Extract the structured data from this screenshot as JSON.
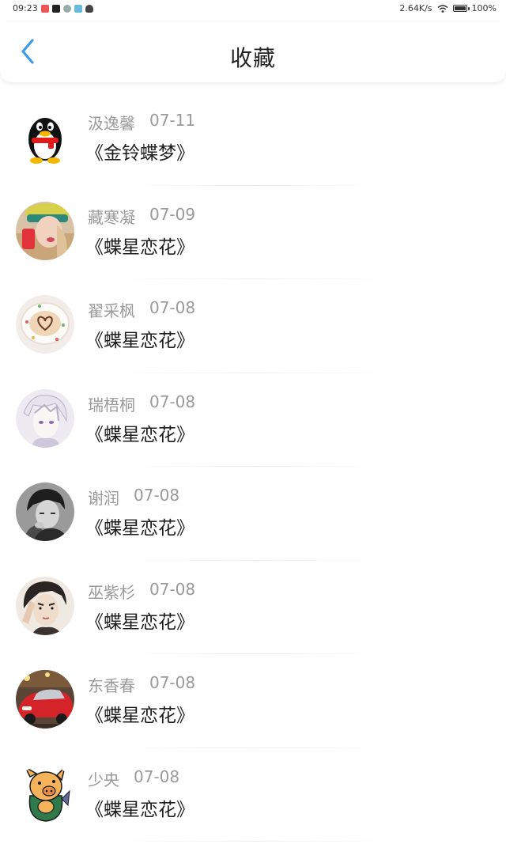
{
  "status_bar": {
    "time": "09:23",
    "net_speed": "2.64K/s",
    "battery": "100%"
  },
  "header": {
    "title": "收藏",
    "back_icon": "chevron-left-icon"
  },
  "colors": {
    "accent": "#3a9bea",
    "meta_text": "#9a9a9a",
    "title_text": "#1e1e1e"
  },
  "favorites": [
    {
      "user": "汲逸馨",
      "date": "07-11",
      "title": "《金铃蝶梦》",
      "avatar": "qq-penguin"
    },
    {
      "user": "藏寒凝",
      "date": "07-09",
      "title": "《蝶星恋花》",
      "avatar": "girl-phone"
    },
    {
      "user": "翟采枫",
      "date": "07-08",
      "title": "《蝶星恋花》",
      "avatar": "latte-heart"
    },
    {
      "user": "瑞梧桐",
      "date": "07-08",
      "title": "《蝶星恋花》",
      "avatar": "anime-boy"
    },
    {
      "user": "谢润",
      "date": "07-08",
      "title": "《蝶星恋花》",
      "avatar": "bw-boy"
    },
    {
      "user": "巫紫杉",
      "date": "07-08",
      "title": "《蝶星恋花》",
      "avatar": "drawn-boy"
    },
    {
      "user": "东香春",
      "date": "07-08",
      "title": "《蝶星恋花》",
      "avatar": "red-car"
    },
    {
      "user": "少央",
      "date": "07-08",
      "title": "《蝶星恋花》",
      "avatar": "cartoon-pig"
    }
  ]
}
